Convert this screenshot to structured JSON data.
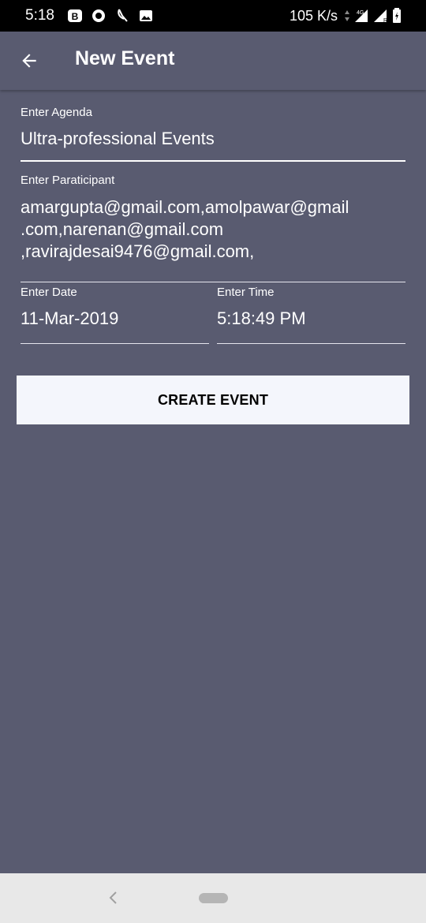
{
  "status_bar": {
    "time": "5:18",
    "icons_left": [
      "b-app-icon",
      "circle-app-icon",
      "moon-icon",
      "image-icon"
    ],
    "net_speed": "105 K/s",
    "signal_badge": "4G",
    "icons_right": [
      "data-arrows-icon",
      "signal-icon",
      "signal-roaming-icon",
      "battery-charging-icon"
    ]
  },
  "app_bar": {
    "title": "New Event",
    "back_icon": "arrow-left-icon"
  },
  "form": {
    "agenda_label": "Enter Agenda",
    "agenda_value": "Ultra-professional Events",
    "participant_label": "Enter Paraticipant",
    "participant_lines": [
      "amargupta@gmail.com,amolpawar@gmail",
      ".com,narenan@gmail.com",
      ",ravirajdesai9476@gmail.com,"
    ],
    "date_label": "Enter Date",
    "date_value": "11-Mar-2019",
    "time_label": "Enter Time",
    "time_value": "5:18:49 PM"
  },
  "create_button_label": "CREATE EVENT",
  "colors": {
    "background": "#595b70",
    "button_bg": "#f4f6fc",
    "status_bar": "#000000",
    "nav_bar": "#e8e8e8"
  }
}
